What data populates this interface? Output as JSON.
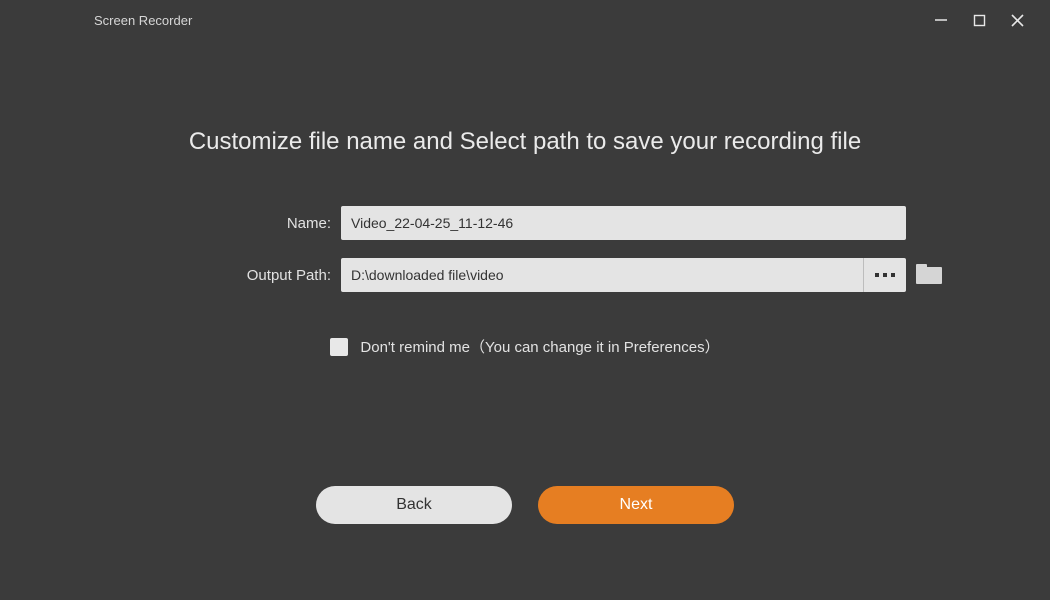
{
  "titlebar": {
    "app_title": "Screen Recorder"
  },
  "heading": "Customize file name and Select path to save your recording file",
  "form": {
    "name_label": "Name:",
    "name_value": "Video_22-04-25_11-12-46",
    "path_label": "Output Path:",
    "path_value": "D:\\downloaded file\\video",
    "browse_dots": "■ ■ ■"
  },
  "remind": {
    "checked": false,
    "label": "Don't remind me（You can change it in Preferences）"
  },
  "buttons": {
    "back": "Back",
    "next": "Next"
  },
  "icons": {
    "minimize": "minimize-icon",
    "maximize": "maximize-icon",
    "close": "close-icon",
    "folder": "folder-icon",
    "browse": "browse-dots-icon"
  }
}
